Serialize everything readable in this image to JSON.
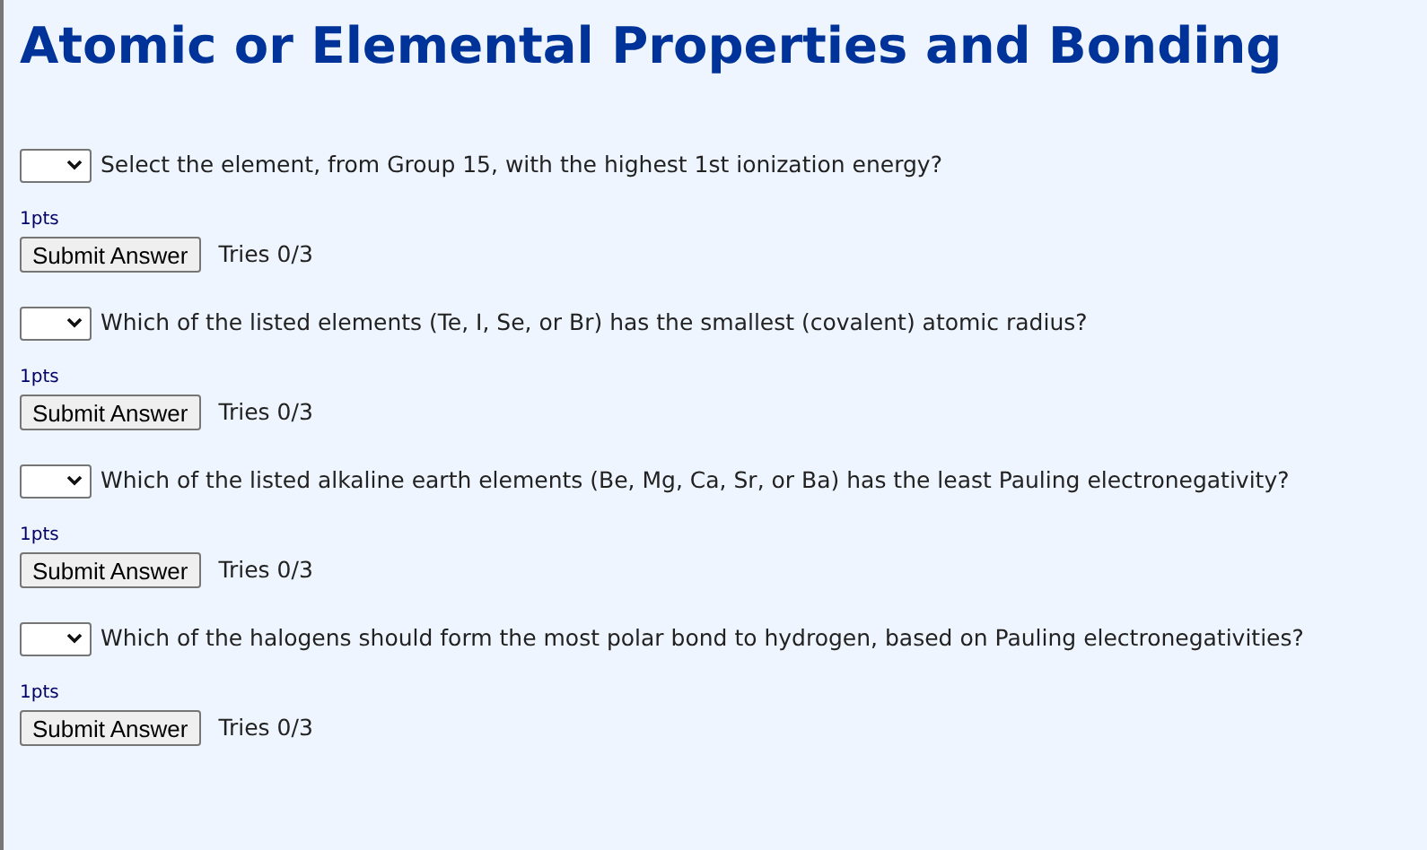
{
  "title": "Atomic or Elemental Properties and Bonding",
  "questions": [
    {
      "text": "Select the element, from Group 15, with the highest 1st ionization energy?",
      "points": "1pts",
      "button": "Submit Answer",
      "tries": "Tries 0/3"
    },
    {
      "text": "Which of the listed elements (Te, I, Se, or Br) has the smallest (covalent) atomic radius?",
      "points": "1pts",
      "button": "Submit Answer",
      "tries": "Tries 0/3"
    },
    {
      "text": "Which of the listed alkaline earth elements (Be, Mg, Ca, Sr, or Ba) has the least Pauling electronegativity?",
      "points": "1pts",
      "button": "Submit Answer",
      "tries": "Tries 0/3"
    },
    {
      "text": "Which of the halogens should form the most polar bond to hydrogen, based on Pauling electronegativities?",
      "points": "1pts",
      "button": "Submit Answer",
      "tries": "Tries 0/3"
    }
  ]
}
